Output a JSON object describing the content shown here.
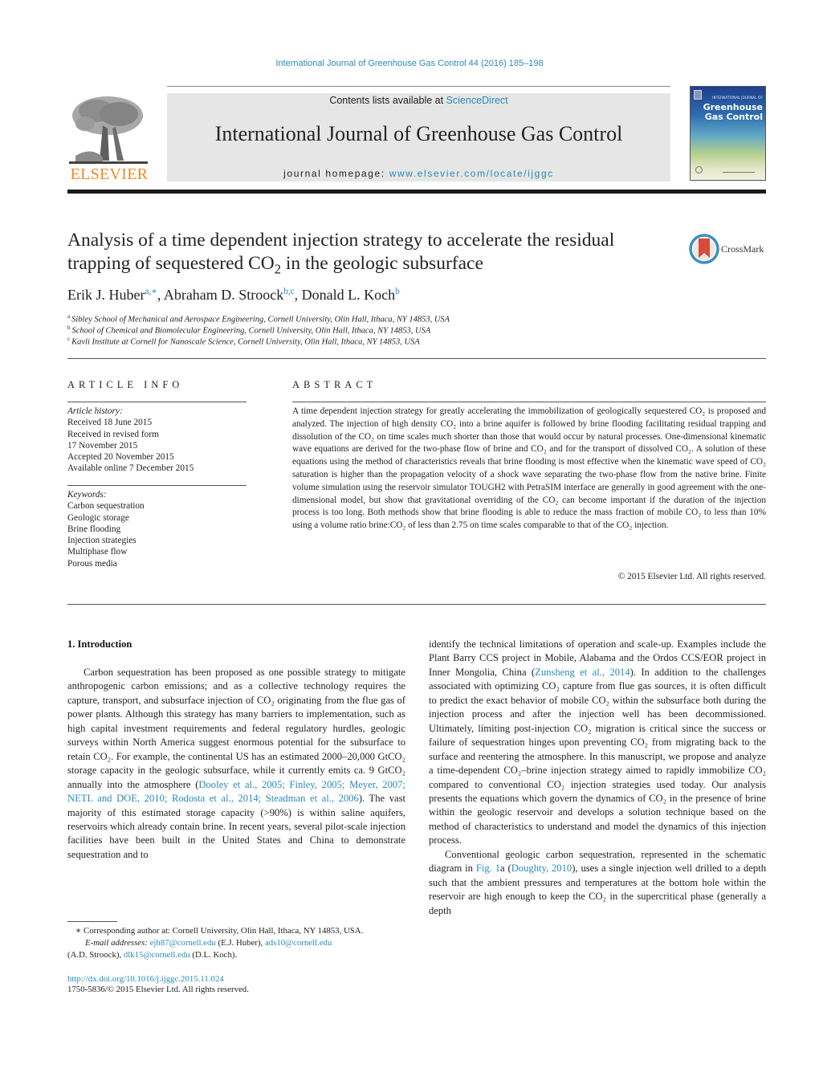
{
  "header": {
    "journal_reference": "International Journal of Greenhouse Gas Control 44 (2016) 185–198",
    "contents_prefix": "Contents lists available at ",
    "contents_link": "ScienceDirect",
    "journal_title": "International Journal of Greenhouse Gas Control",
    "homepage_prefix": "journal homepage: ",
    "homepage_link": "www.elsevier.com/locate/ijggc",
    "publisher": "ELSEVIER",
    "cover_small_text": "INTERNATIONAL JOURNAL OF",
    "cover_title_line1": "Greenhouse",
    "cover_title_line2": "Gas Control",
    "brand_colors": {
      "link": "#2a8ab5",
      "elsevier_orange": "#f08a24",
      "crossmark_red": "#d94a38"
    }
  },
  "article": {
    "title_part1": "Analysis of a time dependent injection strategy to accelerate the residual trapping of sequestered CO",
    "title_sub": "2",
    "title_part2": " in the geologic subsurface",
    "crossmark_label": "CrossMark",
    "authors": [
      {
        "name": "Erik J. Huber",
        "marks": "a,∗",
        "sep": ", "
      },
      {
        "name": "Abraham D. Stroock",
        "marks": "b,c",
        "sep": ", "
      },
      {
        "name": "Donald L. Koch",
        "marks": "b",
        "sep": ""
      }
    ],
    "affiliations": [
      {
        "mark": "a",
        "text": "Sibley School of Mechanical and Aerospace Engineering, Cornell University, Olin Hall, Ithaca, NY 14853, USA"
      },
      {
        "mark": "b",
        "text": "School of Chemical and Biomolecular Engineering, Cornell University, Olin Hall, Ithaca, NY 14853, USA"
      },
      {
        "mark": "c",
        "text": "Kavli Institute at Cornell for Nanoscale Science, Cornell University, Olin Hall, Ithaca, NY 14853, USA"
      }
    ]
  },
  "article_info": {
    "heading": "ARTICLE INFO",
    "history_label": "Article history:",
    "history": [
      "Received 18 June 2015",
      "Received in revised form",
      "17 November 2015",
      "Accepted 20 November 2015",
      "Available online 7 December 2015"
    ],
    "keywords_label": "Keywords:",
    "keywords": [
      "Carbon sequestration",
      "Geologic storage",
      "Brine flooding",
      "Injection strategies",
      "Multiphase flow",
      "Porous media"
    ]
  },
  "abstract": {
    "heading": "ABSTRACT",
    "text": "A time dependent injection strategy for greatly accelerating the immobilization of geologically sequestered CO₂ is proposed and analyzed. The injection of high density CO₂ into a brine aquifer is followed by brine flooding facilitating residual trapping and dissolution of the CO₂ on time scales much shorter than those that would occur by natural processes. One-dimensional kinematic wave equations are derived for the two-phase flow of brine and CO₂ and for the transport of dissolved CO₂. A solution of these equations using the method of characteristics reveals that brine flooding is most effective when the kinematic wave speed of CO₂ saturation is higher than the propagation velocity of a shock wave separating the two-phase flow from the native brine. Finite volume simulation using the reservoir simulator TOUGH2 with PetraSIM interface are generally in good agreement with the one-dimensional model, but show that gravitational overriding of the CO₂ can become important if the duration of the injection process is too long. Both methods show that brine flooding is able to reduce the mass fraction of mobile CO₂ to less than 10% using a volume ratio brine:CO₂ of less than 2.75 on time scales comparable to that of the CO₂ injection.",
    "copyright": "© 2015 Elsevier Ltd. All rights reserved."
  },
  "body": {
    "section_heading": "1.  Introduction",
    "left_p1_a": "Carbon sequestration has been proposed as one possible strategy to mitigate anthropogenic carbon emissions; and as a collective technology requires the capture, transport, and subsurface injection of CO₂ originating from the flue gas of power plants. Although this strategy has many barriers to implementation, such as high capital investment requirements and federal regulatory hurdles, geologic surveys within North America suggest enormous potential for the subsurface to retain CO₂. For example, the continental US has an estimated 2000–20,000 GtCO₂ storage capacity in the geologic subsurface, while it currently emits ca. 9 GtCO₂ annually into the atmosphere (",
    "left_p1_cite": "Dooley et al., 2005; Finley, 2005; Meyer, 2007; NETL and DOE, 2010; Rodosta et al., 2014; Steadman et al., 2006",
    "left_p1_b": "). The vast majority of this estimated storage capacity (>90%) is within saline aquifers, reservoirs which already contain brine. In recent years, several pilot-scale injection facilities have been built in the United States and China to demonstrate sequestration and to",
    "right_p1_a": "identify the technical limitations of operation and scale-up. Examples include the Plant Barry CCS project in Mobile, Alabama and the Ordos CCS/EOR project in Inner Mongolia, China (",
    "right_p1_cite": "Zunsheng et al., 2014",
    "right_p1_b": "). In addition to the challenges associated with optimizing CO₂ capture from flue gas sources, it is often difficult to predict the exact behavior of mobile CO₂ within the subsurface both during the injection process and after the injection well has been decommissioned. Ultimately, limiting post-injection CO₂ migration is critical since the success or failure of sequestration hinges upon preventing CO₂ from migrating back to the surface and reentering the atmosphere. In this manuscript, we propose and analyze a time-dependent CO₂–brine injection strategy aimed to rapidly immobilize CO₂ compared to conventional CO₂ injection strategies used today. Our analysis presents the equations which govern the dynamics of CO₂ in the presence of brine within the geologic reservoir and develops a solution technique based on the method of characteristics to understand and model the dynamics of this injection process.",
    "right_p2_a": "Conventional geologic carbon sequestration, represented in the schematic diagram in ",
    "right_p2_fig": "Fig. 1",
    "right_p2_b": "a (",
    "right_p2_cite": "Doughty, 2010",
    "right_p2_c": "), uses a single injection well drilled to a depth such that the ambient pressures and temperatures at the bottom hole within the reservoir are high enough to keep the CO₂ in the supercritical phase (generally a depth"
  },
  "footnotes": {
    "corresponding": "∗  Corresponding author at: Cornell University, Olin Hall, Ithaca, NY 14853, USA.",
    "email_label": "E-mail addresses:",
    "email_1": "ejh87@cornell.edu",
    "email_1_who": " (E.J. Huber), ",
    "email_2": "ads10@cornell.edu",
    "email_2_who": "(A.D. Stroock), ",
    "email_3": "dlk15@cornell.edu",
    "email_3_who": " (D.L. Koch).",
    "doi": "http://dx.doi.org/10.1016/j.ijggc.2015.11.024",
    "issn": "1750-5836/© 2015 Elsevier Ltd. All rights reserved."
  }
}
